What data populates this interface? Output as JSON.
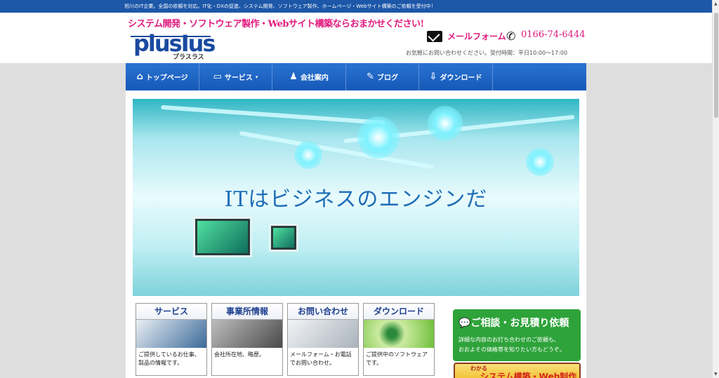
{
  "topbar": {
    "text": "旭川のIT企業。全国の依頼を対応。IT化・DXの促進、システム開発、ソフトウェア製作、ホームページ・Webサイト構築のご依頼を受付中！"
  },
  "header": {
    "tagline": "システム開発・ソフトウェア製作・Webサイト構築ならおまかせください!",
    "logo_text": "plusIus",
    "logo_kana": "プラスラス",
    "mail_label": "メールフォーム",
    "phone": "0166-74-6444",
    "hours": "お気軽にお問い合わせください。受付時間：平日10:00〜17:00"
  },
  "nav": {
    "items": [
      {
        "label": "トップページ",
        "icon": "home-icon",
        "glyph": "⌂"
      },
      {
        "label": "サービス",
        "icon": "computer-icon",
        "glyph": "▭",
        "caret": "▾"
      },
      {
        "label": "会社案内",
        "icon": "people-icon",
        "glyph": "♟"
      },
      {
        "label": "ブログ",
        "icon": "pen-icon",
        "glyph": "✎"
      },
      {
        "label": "ダウンロード",
        "icon": "download-icon",
        "glyph": "⇩"
      }
    ]
  },
  "hero": {
    "title": "ITはビジネスのエンジンだ"
  },
  "cards": [
    {
      "title": "サービス",
      "desc": "ご提供しているお仕事、製品の情報です。",
      "img_color": "#3b6b9a"
    },
    {
      "title": "事業所情報",
      "desc": "会社所在地、略歴。",
      "img_color": "#6a6a6a"
    },
    {
      "title": "お問い合わせ",
      "desc": "メールフォーム・お電話でお問い合わせ。",
      "img_color": "#c9cfd6"
    },
    {
      "title": "ダウンロード",
      "desc": "ご提供中のソフトウェアです。",
      "img_color": "#9fd65a"
    }
  ],
  "promo": {
    "title": "ご相談・お見積り依頼",
    "text1": "詳細な内容のお打ち合わせのご依頼も、",
    "text2": "おおよその価格帯を知りたい方もどうぞ。"
  },
  "banner2": {
    "line1": "わかる",
    "line2": "システム構築・Web制作"
  }
}
